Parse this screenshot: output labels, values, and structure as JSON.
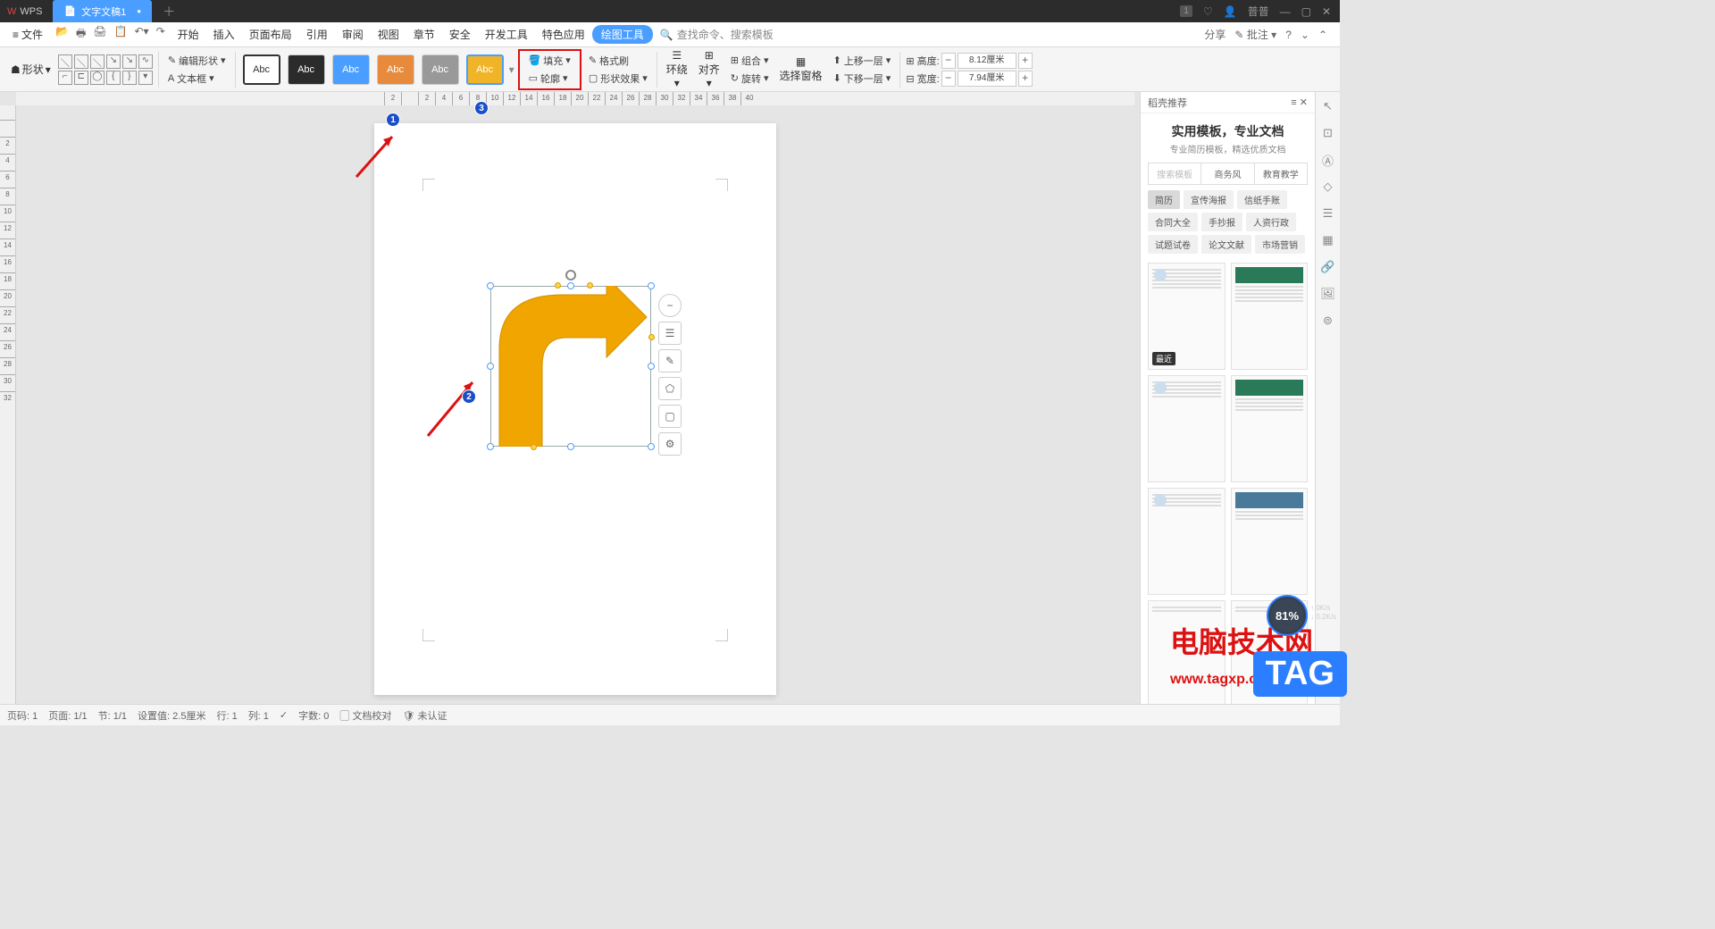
{
  "title": {
    "app": "WPS",
    "doc": "文字文稿1",
    "badge": "1",
    "user": "普普"
  },
  "menu": {
    "file": "文件",
    "items": [
      "开始",
      "插入",
      "页面布局",
      "引用",
      "审阅",
      "视图",
      "章节",
      "安全",
      "开发工具",
      "特色应用",
      "绘图工具"
    ],
    "active": "绘图工具",
    "search_placeholder": "查找命令、搜索模板",
    "share": "分享",
    "comment": "批注"
  },
  "ribbon": {
    "shape": "形状",
    "editShape": "编辑形状",
    "textBox": "文本框",
    "styleLabel": "Abc",
    "fill": "填充",
    "outline": "轮廓",
    "formatBrush": "格式刷",
    "shapeEffect": "形状效果",
    "wrap": "环绕",
    "align": "对齐",
    "rotate": "旋转",
    "group": "组合",
    "selPane": "选择窗格",
    "bringFwd": "上移一层",
    "sendBack": "下移一层",
    "heightLbl": "高度:",
    "heightVal": "8.12厘米",
    "widthLbl": "宽度:",
    "widthVal": "7.94厘米",
    "styleColors": [
      "#ffffff",
      "#2b2b2b",
      "#4a9eff",
      "#e78a3c",
      "#999999",
      "#f0b429"
    ]
  },
  "ruler": {
    "h": [
      "2",
      "",
      "2",
      "4",
      "6",
      "8",
      "10",
      "12",
      "14",
      "16",
      "18",
      "20",
      "22",
      "24",
      "26",
      "28",
      "30",
      "32",
      "34",
      "36",
      "38",
      "40"
    ],
    "v": [
      "",
      "2",
      "4",
      "6",
      "8",
      "10",
      "12",
      "14",
      "16",
      "18",
      "20",
      "22",
      "24",
      "26",
      "28",
      "30",
      "32"
    ]
  },
  "shapeContext": [
    "−",
    "☰",
    "✎",
    "⬠",
    "▢",
    "⚙"
  ],
  "sidepanel": {
    "title": "稻壳推荐",
    "heading": "实用模板，专业文档",
    "subtitle": "专业简历模板，精选优质文档",
    "tabs": [
      "搜索模板",
      "商务风",
      "教育教学"
    ],
    "tags": [
      "简历",
      "宣传海报",
      "信纸手账",
      "合同大全",
      "手抄报",
      "人资行政",
      "试题试卷",
      "论文文献",
      "市场营销"
    ],
    "recent": "最近"
  },
  "status": {
    "page": "页码: 1",
    "pages": "页面: 1/1",
    "section": "节: 1/1",
    "setval": "设置值: 2.5厘米",
    "line": "行: 1",
    "col": "列: 1",
    "words": "字数: 0",
    "proof": "文档校对",
    "auth": "未认证"
  },
  "annot": {
    "n1": "1",
    "n2": "2",
    "n3": "3"
  },
  "overlay": {
    "site": "电脑技术网",
    "url": "www.tagxp.com",
    "tag": "TAG",
    "pct": "81%",
    "up": "0K/s",
    "down": "0.2K/s"
  }
}
